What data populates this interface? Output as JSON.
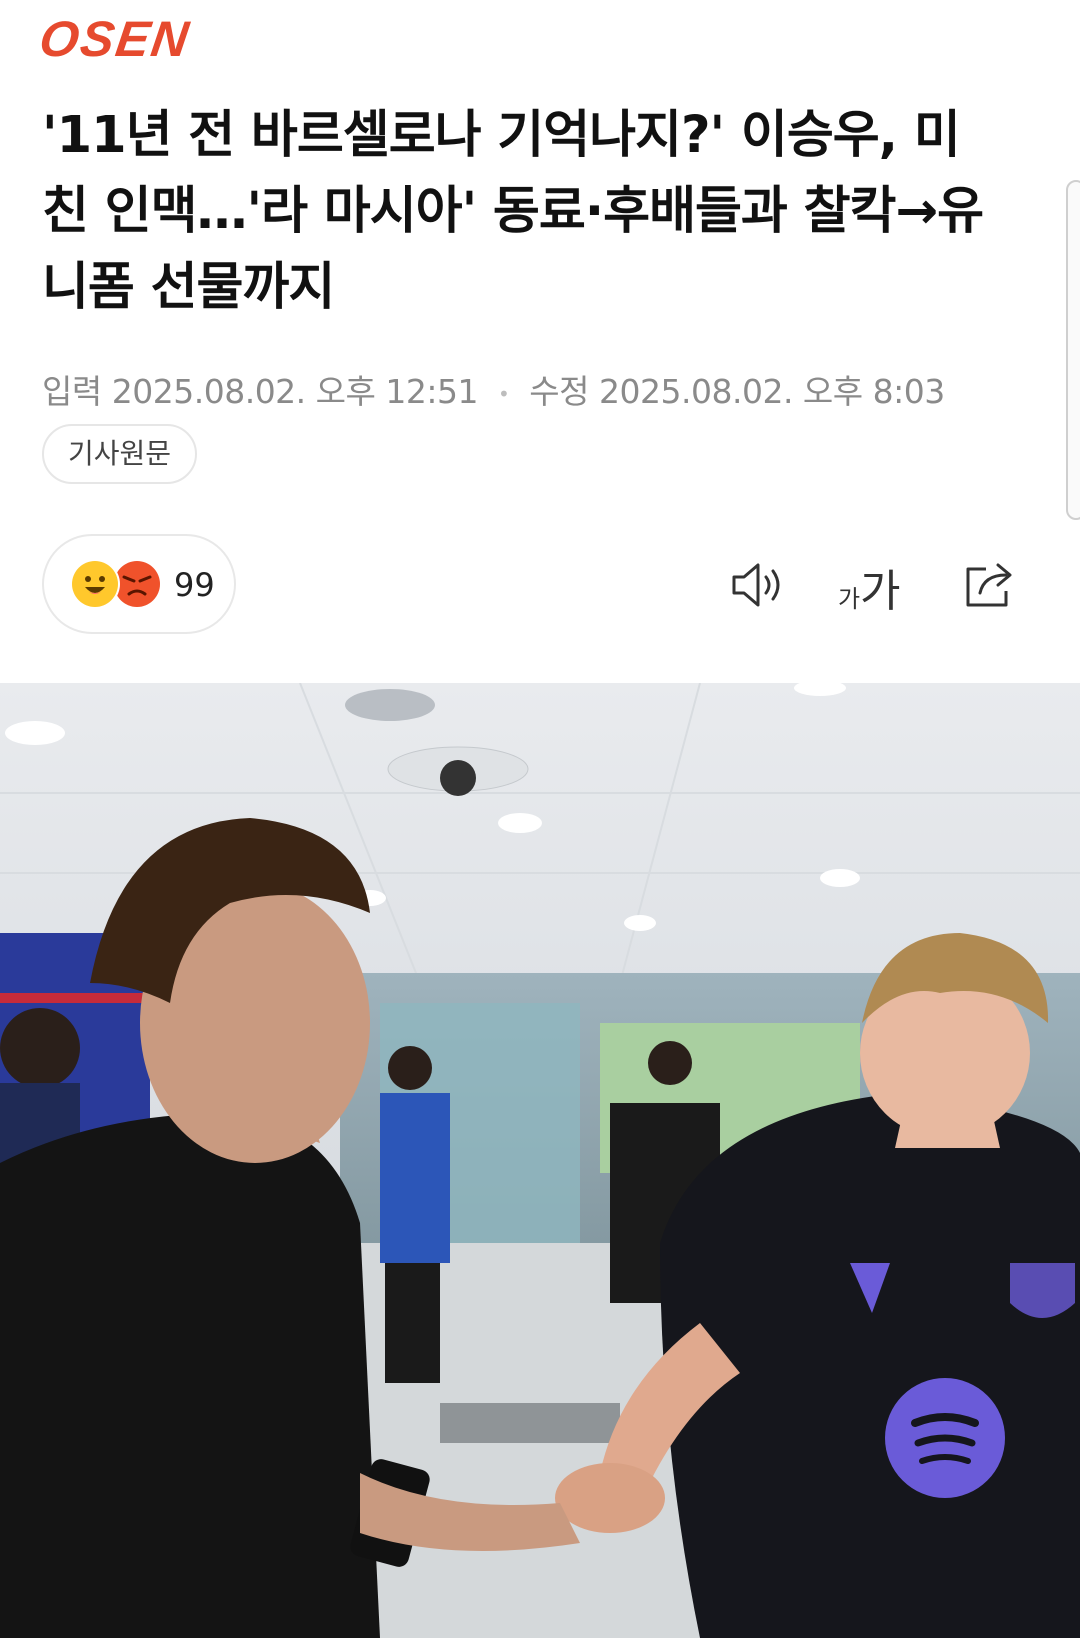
{
  "header": {
    "logo_text": "OSEN"
  },
  "article": {
    "title": "'11년 전 바르셀로나 기억나지?' 이승우, 미친 인맥…'라 마시아' 동료·후배들과 찰칵→유니폼 선물까지",
    "published_label": "입력",
    "published": "2025.08.02. 오후 12:51",
    "modified_label": "수정",
    "modified": "2025.08.02. 오후 8:03",
    "source_chip": "기사원문"
  },
  "toolbar": {
    "reaction_count": "99",
    "font_small": "가",
    "font_large": "가"
  },
  "colors": {
    "brand": "#e64a2e",
    "meta_text": "#8a8a8a",
    "emoji_happy": "#ffc82c",
    "emoji_angry": "#f0522b",
    "jersey_accent": "#6a5bd8"
  },
  "icons": [
    "smile-emoji-icon",
    "angry-emoji-icon",
    "speaker-icon",
    "font-size-icon",
    "share-icon"
  ]
}
